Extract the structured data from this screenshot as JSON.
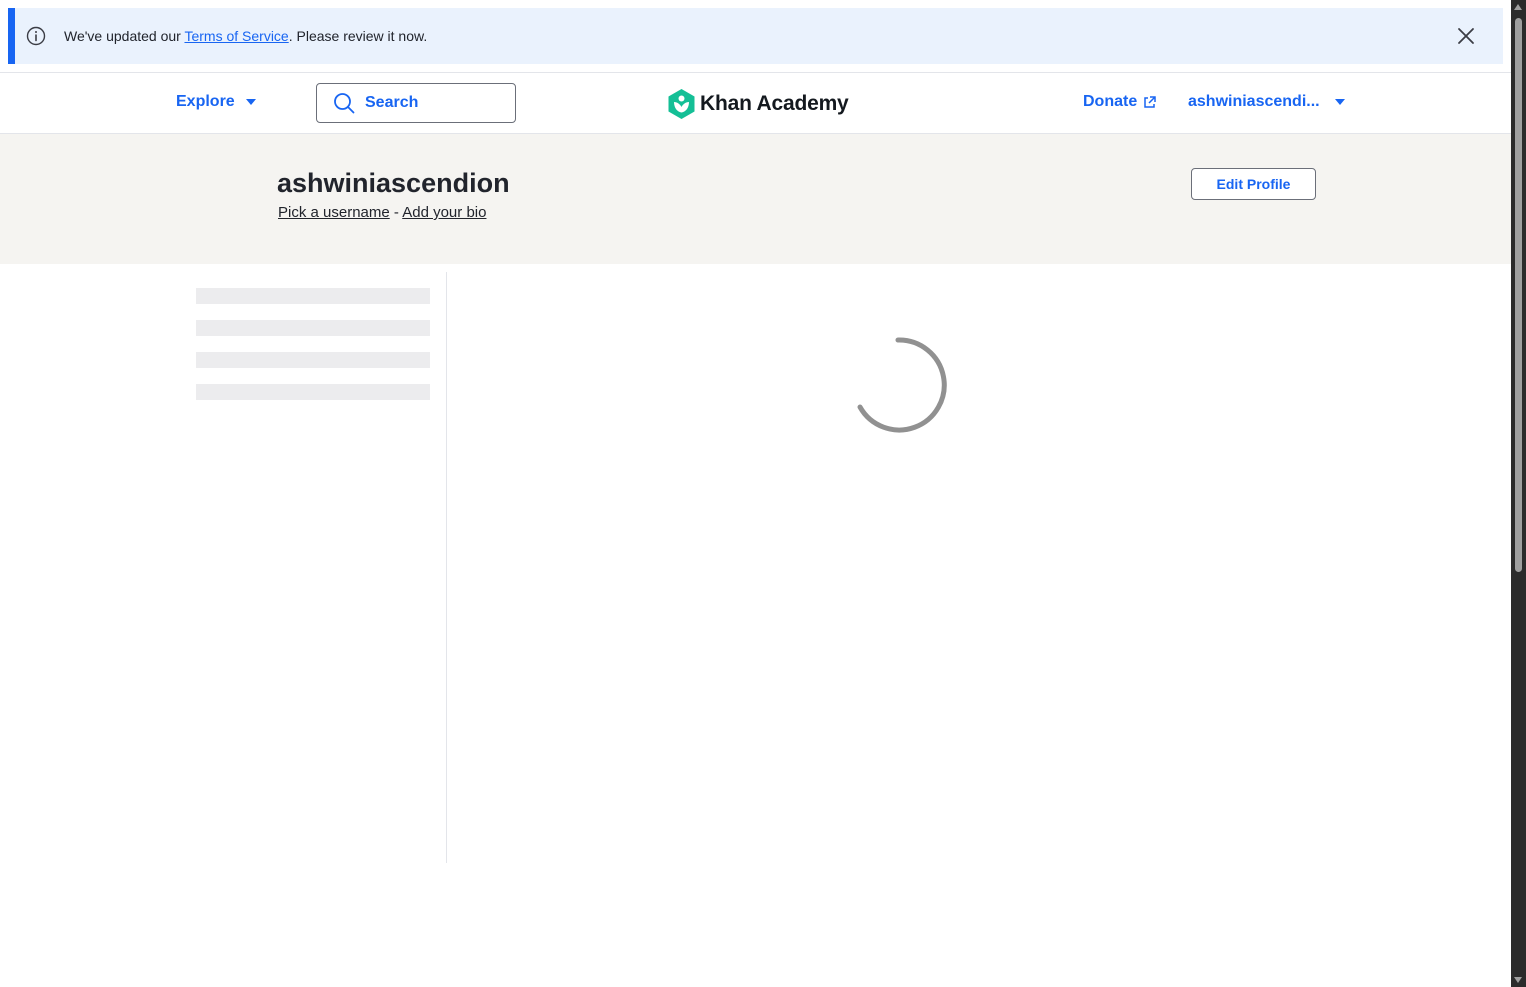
{
  "banner": {
    "text_before": "We've updated our ",
    "link_text": "Terms of Service",
    "text_after": ". Please review it now.",
    "info_icon": "info-icon",
    "close_icon": "close-icon"
  },
  "header": {
    "explore_label": "Explore",
    "search_placeholder": "Search",
    "logo_text": "Khan Academy",
    "donate_label": "Donate",
    "user_label": "ashwiniascendi..."
  },
  "profile": {
    "name": "ashwiniascendion",
    "pick_username": "Pick a username",
    "separator": " - ",
    "add_bio": "Add your bio",
    "edit_button": "Edit Profile"
  },
  "colors": {
    "accent": "#1865f2",
    "banner_bg": "#eaf2fd",
    "profile_band_bg": "#f5f4f1",
    "logo_green": "#14bf96"
  },
  "status": {
    "loading": true
  }
}
